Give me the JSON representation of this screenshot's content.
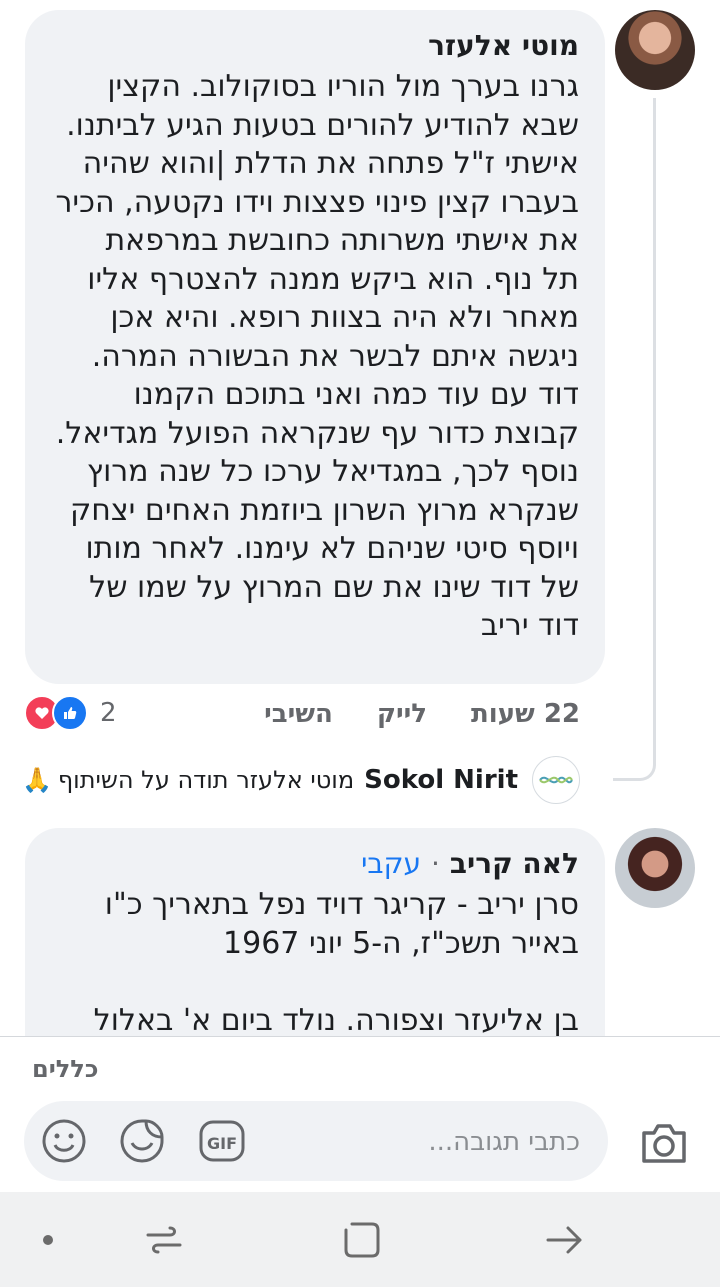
{
  "comment_1": {
    "author": "מוטי אלעזר",
    "lines": [
      "גרנו בערך מול הוריו בסוקולוב. הקצין",
      "שבא להודיע להורים בטעות הגיע לביתנו.",
      "אישתי ז\"ל פתחה את הדלת |והוא שהיה",
      "בעברו קצין פינוי פצצות וידו נקטעה, הכיר",
      "את אישתי משרותה כחובשת במרפאת",
      "תל נוף. הוא ביקש ממנה להצטרף אליו",
      "מאחר ולא היה בצוות רופא. והיא אכן",
      "ניגשה איתם לבשר את הבשורה המרה.",
      "דוד עם עוד כמה ואני בתוכם הקמנו",
      "קבוצת כדור עף שנקראה הפועל מגדיאל.",
      "נוסף לכך, במגדיאל ערכו כל שנה מרוץ",
      "שנקרא מרוץ השרון  ביוזמת האחים יצחק",
      "ויוסף סיטי  שניהם לא עימנו. לאחר מותו",
      "של דוד  שינו את שם המרוץ על שמו של",
      "דוד יריב"
    ],
    "time": "22 שעות",
    "like_label": "לייק",
    "reply_label": "השיבי",
    "reaction_count": "2"
  },
  "reply_1": {
    "author": "Sokol Nirit",
    "text": "מוטי אלעזר תודה על השיתוף",
    "emoji": "🙏"
  },
  "comment_2": {
    "author": "לאה קריב",
    "separator": "·",
    "follow_label": "עקבי",
    "lines": [
      "סרן יריב - קריגר דויד נפל בתאריך כ\"ו",
      "באייר תשכ\"ז, ה-5 יוני 1967",
      "",
      "בן אליעזר וצפורה. נולד ביום א' באלול"
    ]
  },
  "composer": {
    "rules_label": "כללים",
    "placeholder": "כתבי תגובה..."
  },
  "colors": {
    "accent": "#1877f2",
    "bubble": "#f0f2f5",
    "secondary_text": "#65676b",
    "love": "#f33e58"
  },
  "icons": [
    "camera-icon",
    "gif-icon",
    "sticker-icon",
    "emoji-icon",
    "like-reaction-icon",
    "love-reaction-icon",
    "back-icon",
    "home-icon",
    "recents-icon"
  ]
}
